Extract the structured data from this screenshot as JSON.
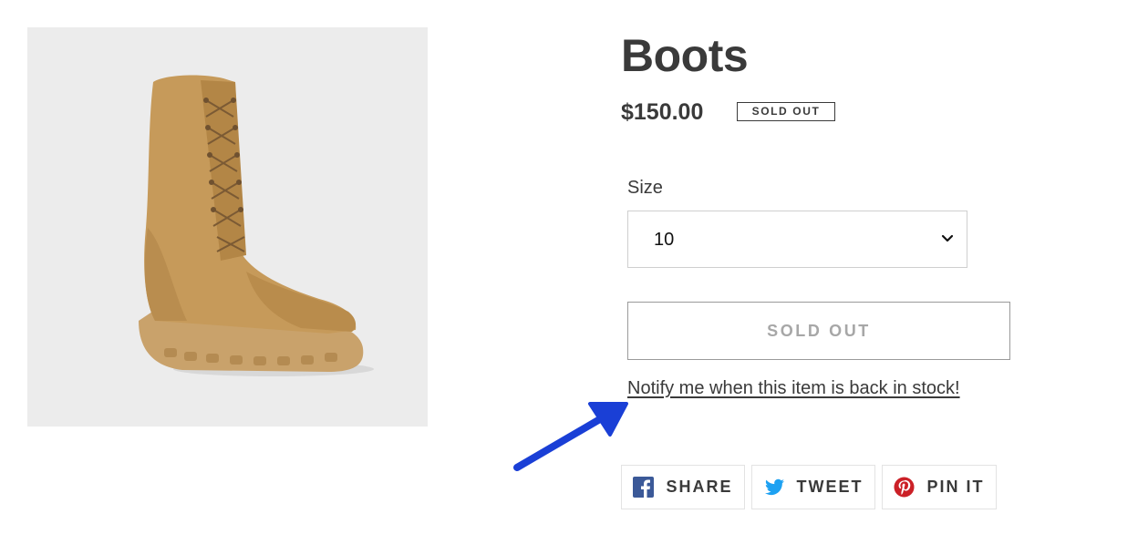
{
  "product": {
    "image_alt": "boot-product-image",
    "title": "Boots",
    "price": "$150.00",
    "badge": "SOLD OUT"
  },
  "size": {
    "label": "Size",
    "selected": "10"
  },
  "actions": {
    "sold_out_button": "SOLD OUT",
    "notify_link": "Notify me when this item is back in stock!"
  },
  "share": {
    "facebook": "SHARE",
    "twitter": "TWEET",
    "pinterest": "PIN IT"
  },
  "colors": {
    "text": "#3a3a3a",
    "image_bg": "#ececec",
    "arrow": "#1a3fd6",
    "facebook": "#3b5998",
    "twitter": "#1da1f2",
    "pinterest": "#cb2027"
  },
  "icons": {
    "select": "chevron-down-icon",
    "facebook": "facebook-icon",
    "twitter": "twitter-icon",
    "pinterest": "pinterest-icon",
    "annotation": "annotation-arrow"
  }
}
